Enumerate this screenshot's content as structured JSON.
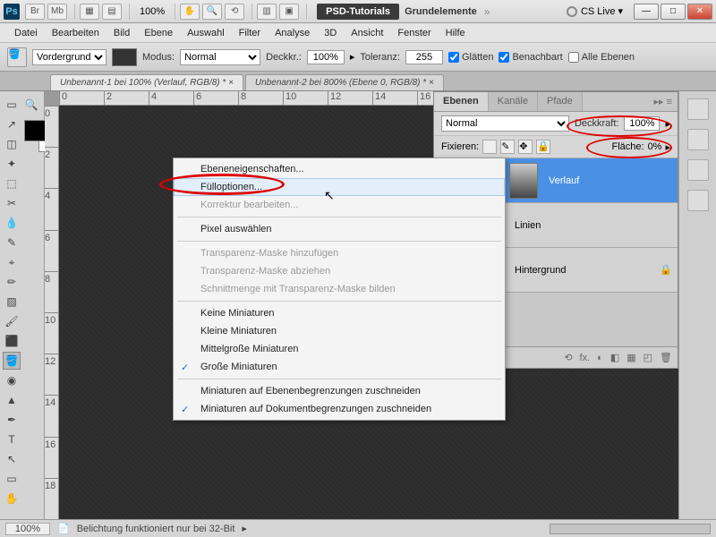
{
  "titlebar": {
    "ps": "Ps",
    "br": "Br",
    "mb": "Mb",
    "zoom": "100%",
    "psd_tut": "PSD-Tutorials",
    "grund": "Grundelemente",
    "cslive": "CS Live"
  },
  "menu": [
    "Datei",
    "Bearbeiten",
    "Bild",
    "Ebene",
    "Auswahl",
    "Filter",
    "Analyse",
    "3D",
    "Ansicht",
    "Fenster",
    "Hilfe"
  ],
  "optbar": {
    "vordergrund": "Vordergrund",
    "modus_lbl": "Modus:",
    "modus_val": "Normal",
    "deckkr_lbl": "Deckkr.:",
    "deckkr_val": "100%",
    "toleranz_lbl": "Toleranz:",
    "toleranz_val": "255",
    "glatten": "Glätten",
    "benachbart": "Benachbart",
    "alle": "Alle Ebenen"
  },
  "tabs": [
    "Unbenannt-1 bei 100% (Verlauf, RGB/8) * ×",
    "Unbenannt-2 bei 800% (Ebene 0, RGB/8) * ×"
  ],
  "ruler_h": [
    "0",
    "2",
    "4",
    "6",
    "8",
    "10",
    "12",
    "14",
    "16"
  ],
  "ruler_v": [
    "0",
    "2",
    "4",
    "6",
    "8",
    "10",
    "12",
    "14",
    "16",
    "18"
  ],
  "panel": {
    "tabs": [
      "Ebenen",
      "Kanäle",
      "Pfade"
    ],
    "blend": "Normal",
    "deckkraft_lbl": "Deckkraft:",
    "deckkraft_val": "100%",
    "fixieren_lbl": "Fixieren:",
    "flache_lbl": "Fläche:",
    "flache_val": "0%",
    "layers": [
      {
        "name": "Verlauf"
      },
      {
        "name": "Linien"
      },
      {
        "name": "Hintergrund"
      }
    ],
    "footer_icons": [
      "⟲",
      "fx.",
      "◐",
      "◧",
      "▦",
      "◰",
      "🗑"
    ]
  },
  "ctx": [
    {
      "t": "Ebeneneigenschaften..."
    },
    {
      "t": "Fülloptionen...",
      "hover": true
    },
    {
      "t": "Korrektur bearbeiten...",
      "disabled": true
    },
    {
      "sep": true
    },
    {
      "t": "Pixel auswählen"
    },
    {
      "sep": true
    },
    {
      "t": "Transparenz-Maske hinzufügen",
      "disabled": true
    },
    {
      "t": "Transparenz-Maske abziehen",
      "disabled": true
    },
    {
      "t": "Schnittmenge mit Transparenz-Maske bilden",
      "disabled": true
    },
    {
      "sep": true
    },
    {
      "t": "Keine Miniaturen"
    },
    {
      "t": "Kleine Miniaturen"
    },
    {
      "t": "Mittelgroße Miniaturen"
    },
    {
      "t": "Große Miniaturen",
      "checked": true
    },
    {
      "sep": true
    },
    {
      "t": "Miniaturen auf Ebenenbegrenzungen zuschneiden"
    },
    {
      "t": "Miniaturen auf Dokumentbegrenzungen zuschneiden",
      "checked": true
    }
  ],
  "status": {
    "zoom": "100%",
    "msg": "Belichtung funktioniert nur bei 32-Bit"
  }
}
